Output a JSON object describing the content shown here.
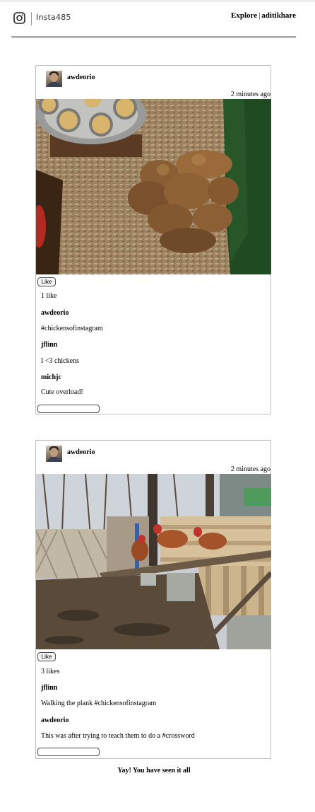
{
  "header": {
    "logo_text": "Insta485",
    "logo_icon": "instagram-camera-icon",
    "nav_explore": "Explore",
    "nav_separator": "|",
    "nav_user": "aditikhare"
  },
  "posts": [
    {
      "owner": "awdeorio",
      "timestamp": "2 minutes ago",
      "photo_alt": "chicks-in-brooder",
      "like_label": "Like",
      "likes_text": "1 like",
      "comments": [
        {
          "owner": "awdeorio",
          "text": "#chickensofinstagram"
        },
        {
          "owner": "jflinn",
          "text": "I <3 chickens"
        },
        {
          "owner": "michjc",
          "text": "Cute overload!"
        }
      ],
      "comment_value": ""
    },
    {
      "owner": "awdeorio",
      "timestamp": "2 minutes ago",
      "photo_alt": "chickens-on-plank",
      "like_label": "Like",
      "likes_text": "3 likes",
      "comments": [
        {
          "owner": "jflinn",
          "text": "Walking the plank #chickensofinstagram"
        },
        {
          "owner": "awdeorio",
          "text": "This was after trying to teach them to do a #crossword"
        }
      ],
      "comment_value": ""
    }
  ],
  "footer": {
    "end_message": "Yay! You have seen it all"
  }
}
